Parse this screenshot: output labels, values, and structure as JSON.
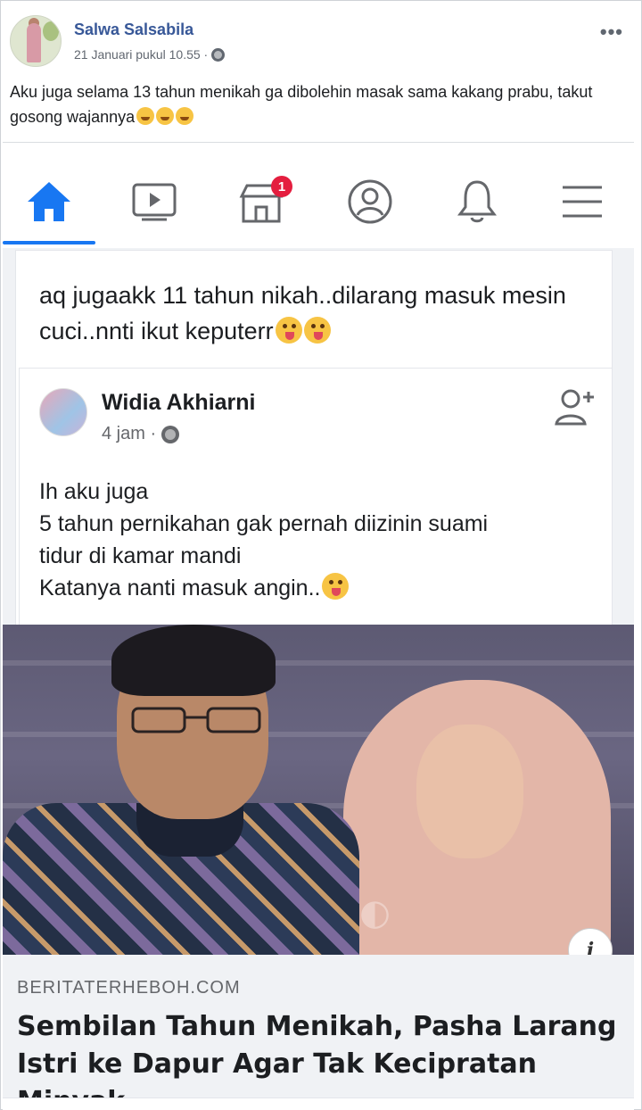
{
  "post": {
    "author": "Salwa Salsabila",
    "timestamp": "21 Januari pukul 10.55 ·",
    "privacy_icon": "globe-icon",
    "more_label": "•••",
    "text": "Aku juga selama 13 tahun menikah ga dibolehin masak sama kakang prabu, takut gosong wajannya",
    "emoji_count": 3
  },
  "shared_screenshot": {
    "nav": {
      "items": [
        {
          "name": "home",
          "icon": "home-icon",
          "active": true
        },
        {
          "name": "watch",
          "icon": "video-icon"
        },
        {
          "name": "marketplace",
          "icon": "marketplace-icon",
          "badge": "1"
        },
        {
          "name": "profile",
          "icon": "profile-icon"
        },
        {
          "name": "notifications",
          "icon": "bell-icon"
        },
        {
          "name": "menu",
          "icon": "menu-icon"
        }
      ],
      "accent": "#1877f2",
      "badge_color": "#e41e3f"
    },
    "comment": {
      "text": "aq jugaakk 11 tahun nikah..dilarang masuk mesin cuci..nnti ikut keputerr"
    },
    "quoted_post": {
      "author": "Widia Akhiarni",
      "time": "4 jam ·",
      "lines": [
        "Ih aku juga",
        "5 tahun pernikahan gak pernah diizinin suami",
        "tidur di kamar mandi",
        "Katanya nanti masuk angin.."
      ]
    },
    "article": {
      "info_label": "i",
      "domain": "BERITATERHEBOH.COM",
      "headline": "Sembilan Tahun Menikah, Pasha Larang Istri ke Dapur Agar Tak Kecipratan Minyak"
    }
  }
}
